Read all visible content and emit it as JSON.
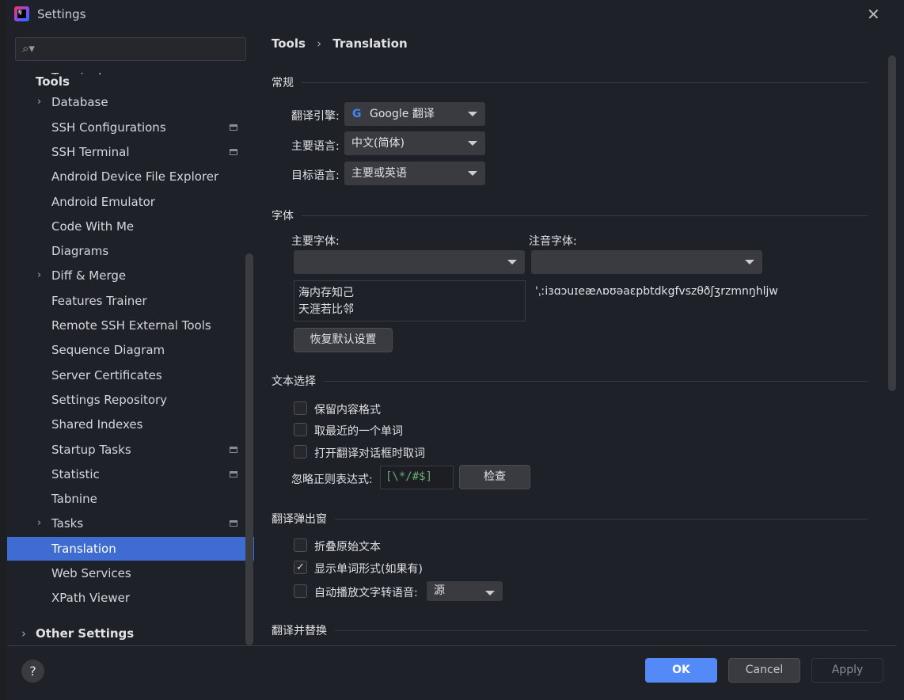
{
  "window": {
    "title": "Settings"
  },
  "search": {
    "placeholder": ""
  },
  "sidebar": {
    "header": "Tools",
    "items": [
      {
        "label": "Terminal",
        "arrow": false,
        "page_icon": true
      },
      {
        "label": "Database",
        "arrow": true,
        "page_icon": false
      },
      {
        "label": "SSH Configurations",
        "arrow": false,
        "page_icon": true
      },
      {
        "label": "SSH Terminal",
        "arrow": false,
        "page_icon": true
      },
      {
        "label": "Android Device File Explorer",
        "arrow": false,
        "page_icon": false
      },
      {
        "label": "Android Emulator",
        "arrow": false,
        "page_icon": false
      },
      {
        "label": "Code With Me",
        "arrow": false,
        "page_icon": false
      },
      {
        "label": "Diagrams",
        "arrow": false,
        "page_icon": false
      },
      {
        "label": "Diff & Merge",
        "arrow": true,
        "page_icon": false
      },
      {
        "label": "Features Trainer",
        "arrow": false,
        "page_icon": false
      },
      {
        "label": "Remote SSH External Tools",
        "arrow": false,
        "page_icon": false
      },
      {
        "label": "Sequence Diagram",
        "arrow": false,
        "page_icon": false
      },
      {
        "label": "Server Certificates",
        "arrow": false,
        "page_icon": false
      },
      {
        "label": "Settings Repository",
        "arrow": false,
        "page_icon": false
      },
      {
        "label": "Shared Indexes",
        "arrow": false,
        "page_icon": false
      },
      {
        "label": "Startup Tasks",
        "arrow": false,
        "page_icon": true
      },
      {
        "label": "Statistic",
        "arrow": false,
        "page_icon": true
      },
      {
        "label": "Tabnine",
        "arrow": false,
        "page_icon": false
      },
      {
        "label": "Tasks",
        "arrow": true,
        "page_icon": true
      },
      {
        "label": "Translation",
        "arrow": false,
        "page_icon": false,
        "selected": true
      },
      {
        "label": "Web Services",
        "arrow": false,
        "page_icon": false
      },
      {
        "label": "XPath Viewer",
        "arrow": false,
        "page_icon": false
      }
    ],
    "other": "Other Settings"
  },
  "breadcrumb": {
    "parent": "Tools",
    "sep": "›",
    "current": "Translation"
  },
  "general": {
    "title": "常规",
    "engine_label": "翻译引擎:",
    "engine_value": "Google 翻译",
    "primary_label": "主要语言:",
    "primary_value": "中文(简体)",
    "target_label": "目标语言:",
    "target_value": "主要或英语"
  },
  "font": {
    "title": "字体",
    "primary_label": "主要字体:",
    "phonetic_label": "注音字体:",
    "primary_value": "",
    "phonetic_value": "",
    "preview_line1": "海内存知己",
    "preview_line2": "天涯若比邻",
    "phonetic_preview": "'ˌːiɜɑɔuɪeæʌɒʊəaɛpbtdkgfvszθðʃʒrzmnŋhljw",
    "reset": "恢复默认设置"
  },
  "selection": {
    "title": "文本选择",
    "keep_format": "保留内容格式",
    "keep_format_checked": false,
    "nearest_word": "取最近的一个单词",
    "nearest_word_checked": false,
    "take_on_open": "打开翻译对话框时取词",
    "take_on_open_checked": false,
    "ignore_label": "忽略正则表达式:",
    "ignore_value": "[\\*/#$]",
    "check": "检查"
  },
  "popup": {
    "title": "翻译弹出窗",
    "fold": "折叠原始文本",
    "fold_checked": false,
    "word_forms": "显示单词形式(如果有)",
    "word_forms_checked": true,
    "autoplay": "自动播放文字转语音:",
    "autoplay_checked": false,
    "autoplay_value": "源"
  },
  "replace": {
    "title": "翻译并替换"
  },
  "footer": {
    "help": "?",
    "ok": "OK",
    "cancel": "Cancel",
    "apply": "Apply"
  },
  "colors": {
    "accent": "#3e6cd1",
    "ok": "#548af7"
  }
}
